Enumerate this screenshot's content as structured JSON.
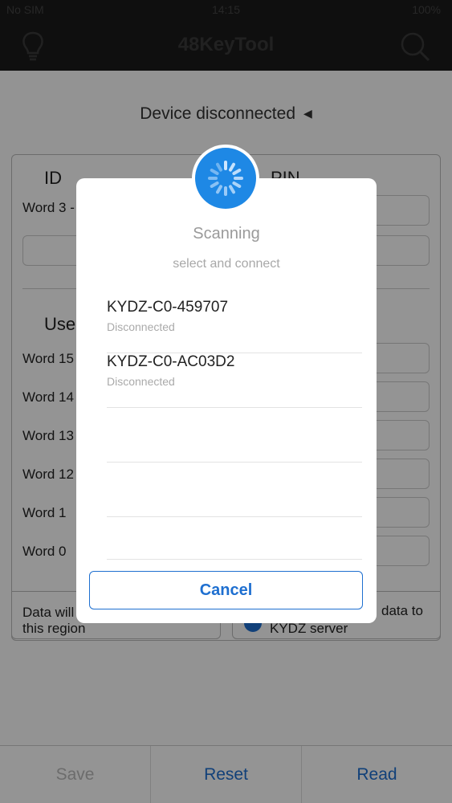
{
  "status_bar": {
    "carrier": "No SIM",
    "time": "14:15",
    "battery": "100%"
  },
  "nav": {
    "title": "48KeyTool",
    "left_icon": "lightbulb-icon",
    "right_icon": "search-icon"
  },
  "page": {
    "device_status": "Device disconnected",
    "id_label": "ID",
    "pin_label": "PIN",
    "word3_label": "Word 3 -",
    "user_label": "Use",
    "word_labels": [
      "Word 15",
      "Word 14",
      "Word 13",
      "Word 12",
      "Word 1",
      "Word 0"
    ],
    "left_note_1": "Data will",
    "left_note_2": "this region",
    "right_note_1": "data to",
    "right_note_2": "KYDZ server"
  },
  "bottom": {
    "save": "Save",
    "reset": "Reset",
    "read": "Read"
  },
  "dialog": {
    "title": "Scanning",
    "subtitle": "select and connect",
    "devices": [
      {
        "name": "KYDZ-C0-459707",
        "status": "Disconnected"
      },
      {
        "name": "KYDZ-C0-AC03D2",
        "status": "Disconnected"
      }
    ],
    "cancel": "Cancel"
  },
  "colors": {
    "accent": "#1e6fd0",
    "spinner": "#1e88e5",
    "navbar": "#1b1b1b"
  }
}
